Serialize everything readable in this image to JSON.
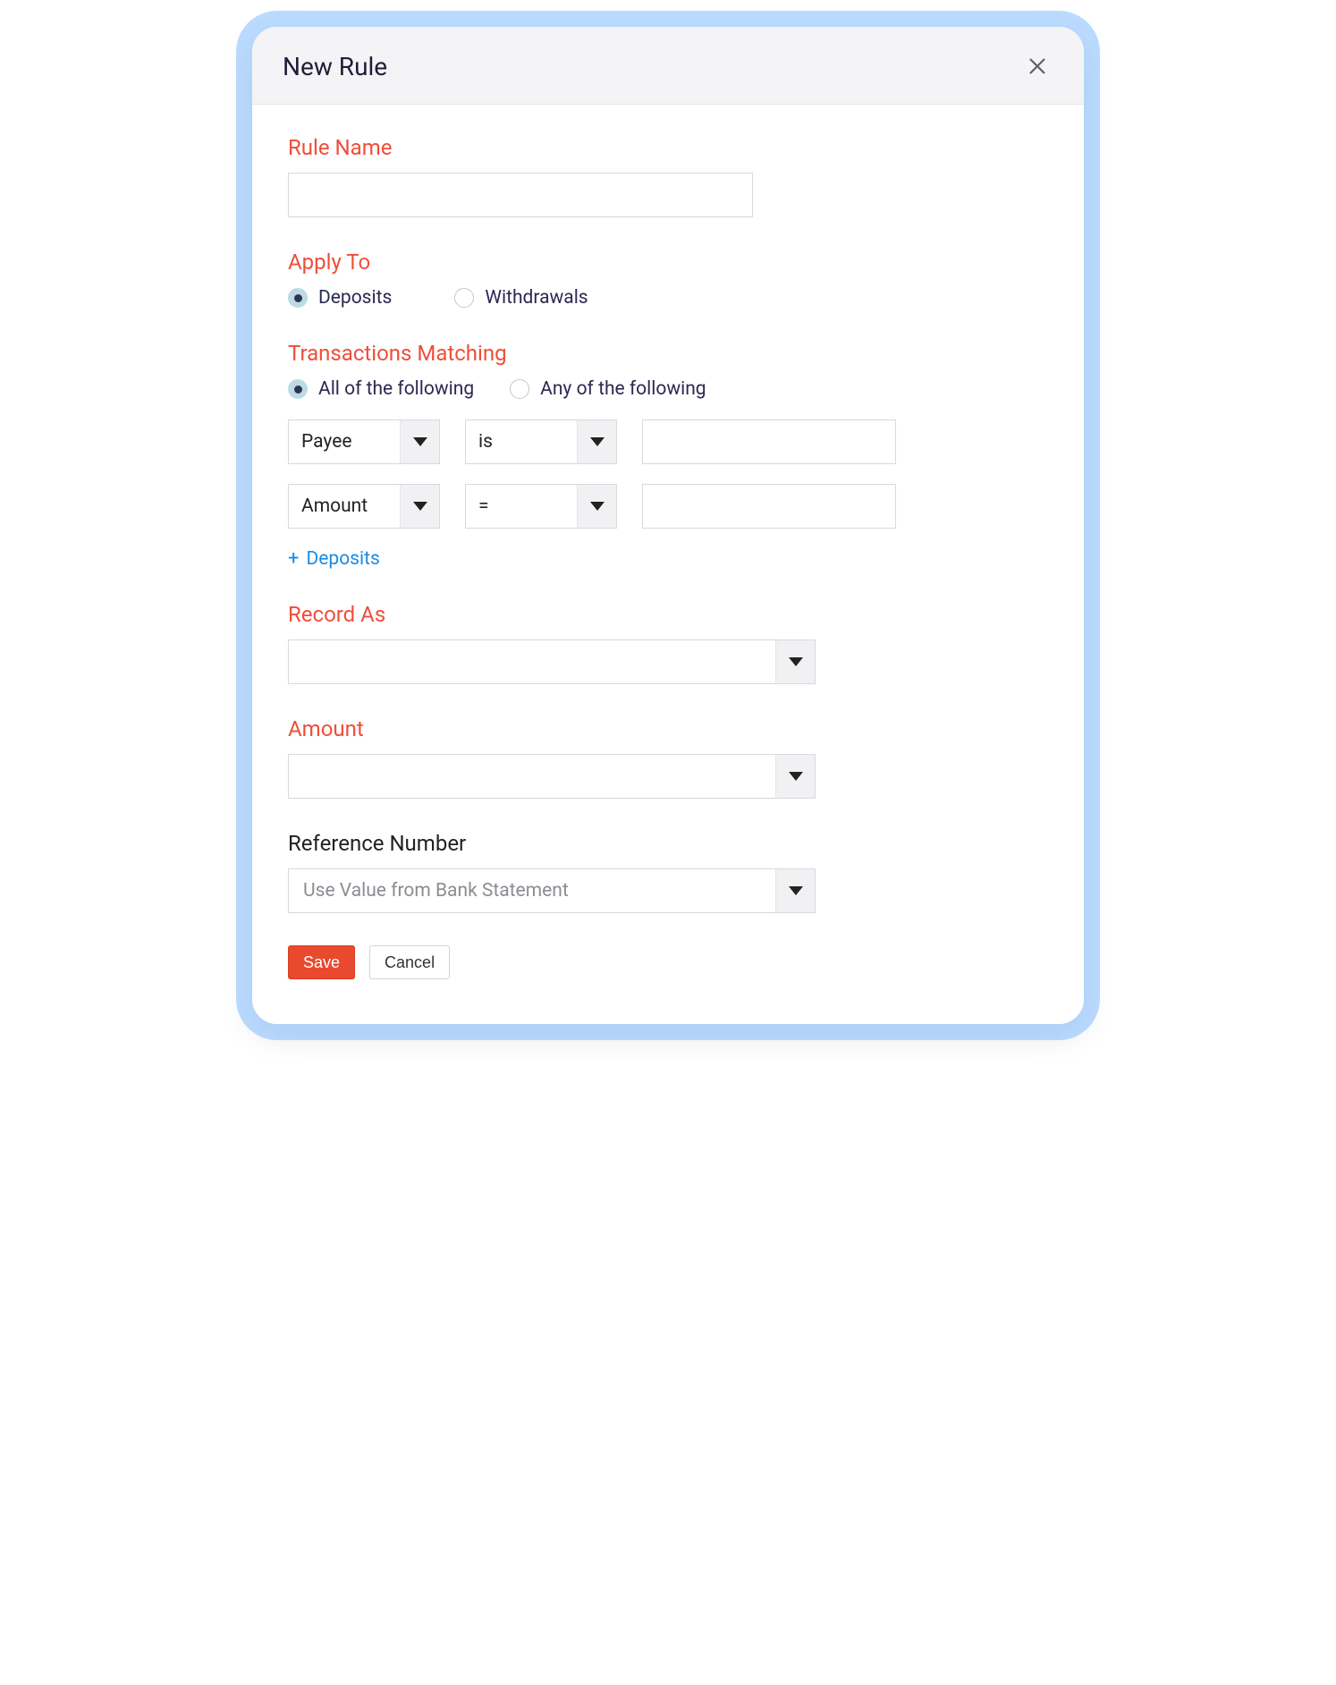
{
  "modal": {
    "title": "New Rule"
  },
  "rule_name": {
    "label": "Rule Name",
    "value": ""
  },
  "apply_to": {
    "label": "Apply To",
    "options": {
      "deposits": "Deposits",
      "withdrawals": "Withdrawals"
    },
    "selected": "deposits"
  },
  "transactions_matching": {
    "label": "Transactions Matching",
    "mode_options": {
      "all": "All of the following",
      "any": "Any of the following"
    },
    "mode_selected": "all",
    "conditions": [
      {
        "field": "Payee",
        "operator": "is",
        "value": ""
      },
      {
        "field": "Amount",
        "operator": "=",
        "value": ""
      }
    ],
    "add_link": "Deposits"
  },
  "record_as": {
    "label": "Record As",
    "value": ""
  },
  "amount": {
    "label": "Amount",
    "value": ""
  },
  "reference_number": {
    "label": "Reference Number",
    "value": "Use Value from Bank Statement"
  },
  "buttons": {
    "save": "Save",
    "cancel": "Cancel"
  }
}
